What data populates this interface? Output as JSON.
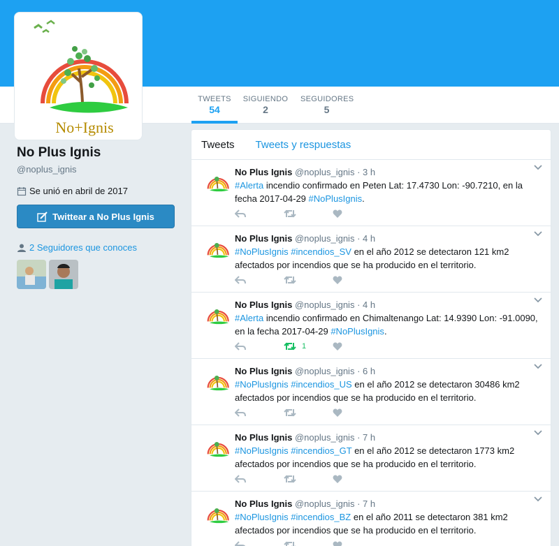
{
  "profile": {
    "name": "No Plus Ignis",
    "handle": "@noplus_ignis",
    "joined": "Se unió en abril de 2017",
    "tweet_button": "Twittear a No Plus Ignis",
    "followers_you_know": "2 Seguidores que conoces",
    "logo_text": "No+Ignis"
  },
  "stats": [
    {
      "label": "TWEETS",
      "value": "54"
    },
    {
      "label": "SIGUIENDO",
      "value": "2"
    },
    {
      "label": "SEGUIDORES",
      "value": "5"
    }
  ],
  "tabs": {
    "tweets": "Tweets",
    "replies": "Tweets y respuestas"
  },
  "tweets": [
    {
      "name": "No Plus Ignis",
      "handle": "@noplus_ignis",
      "dot": "·",
      "time": "3 h",
      "parts": [
        [
          "#Alerta",
          "tag"
        ],
        [
          " incendio confirmado en Peten Lat: 17.4730 Lon: -90.7210, en la fecha 2017-04-29 ",
          "text"
        ],
        [
          "#NoPlusIgnis",
          "tag"
        ],
        [
          ".",
          "text"
        ]
      ],
      "retweets": ""
    },
    {
      "name": "No Plus Ignis",
      "handle": "@noplus_ignis",
      "dot": "·",
      "time": "4 h",
      "parts": [
        [
          "#NoPlusIgnis",
          "tag"
        ],
        [
          " ",
          "text"
        ],
        [
          "#incendios_SV",
          "tag"
        ],
        [
          " en el año 2012 se detectaron 121 km2 afectados por incendios que se ha producido en el territorio.",
          "text"
        ]
      ],
      "retweets": ""
    },
    {
      "name": "No Plus Ignis",
      "handle": "@noplus_ignis",
      "dot": "·",
      "time": "4 h",
      "parts": [
        [
          "#Alerta",
          "tag"
        ],
        [
          " incendio confirmado en Chimaltenango Lat: 14.9390 Lon: -91.0090, en la fecha 2017-04-29 ",
          "text"
        ],
        [
          "#NoPlusIgnis",
          "tag"
        ],
        [
          ".",
          "text"
        ]
      ],
      "retweets": "1"
    },
    {
      "name": "No Plus Ignis",
      "handle": "@noplus_ignis",
      "dot": "·",
      "time": "6 h",
      "parts": [
        [
          "#NoPlusIgnis",
          "tag"
        ],
        [
          " ",
          "text"
        ],
        [
          "#incendios_US",
          "tag"
        ],
        [
          " en el año 2012 se detectaron 30486 km2 afectados por incendios que se ha producido en el territorio.",
          "text"
        ]
      ],
      "retweets": ""
    },
    {
      "name": "No Plus Ignis",
      "handle": "@noplus_ignis",
      "dot": "·",
      "time": "7 h",
      "parts": [
        [
          "#NoPlusIgnis",
          "tag"
        ],
        [
          " ",
          "text"
        ],
        [
          "#incendios_GT",
          "tag"
        ],
        [
          " en el año 2012 se detectaron 1773 km2 afectados por incendios que se ha producido en el territorio.",
          "text"
        ]
      ],
      "retweets": ""
    },
    {
      "name": "No Plus Ignis",
      "handle": "@noplus_ignis",
      "dot": "·",
      "time": "7 h",
      "parts": [
        [
          "#NoPlusIgnis",
          "tag"
        ],
        [
          " ",
          "text"
        ],
        [
          "#incendios_BZ",
          "tag"
        ],
        [
          " en el año 2011 se detectaron 381 km2 afectados por incendios que se ha producido en el territorio.",
          "text"
        ]
      ],
      "retweets": ""
    }
  ],
  "colors": {
    "brand": "#1da1f2",
    "link": "#1b95e0",
    "retweet_active": "#17bf63",
    "muted": "#657786"
  },
  "icons": [
    "calendar-icon",
    "quill-icon",
    "user-icon",
    "reply-icon",
    "retweet-icon",
    "heart-icon",
    "chevron-down-icon"
  ]
}
